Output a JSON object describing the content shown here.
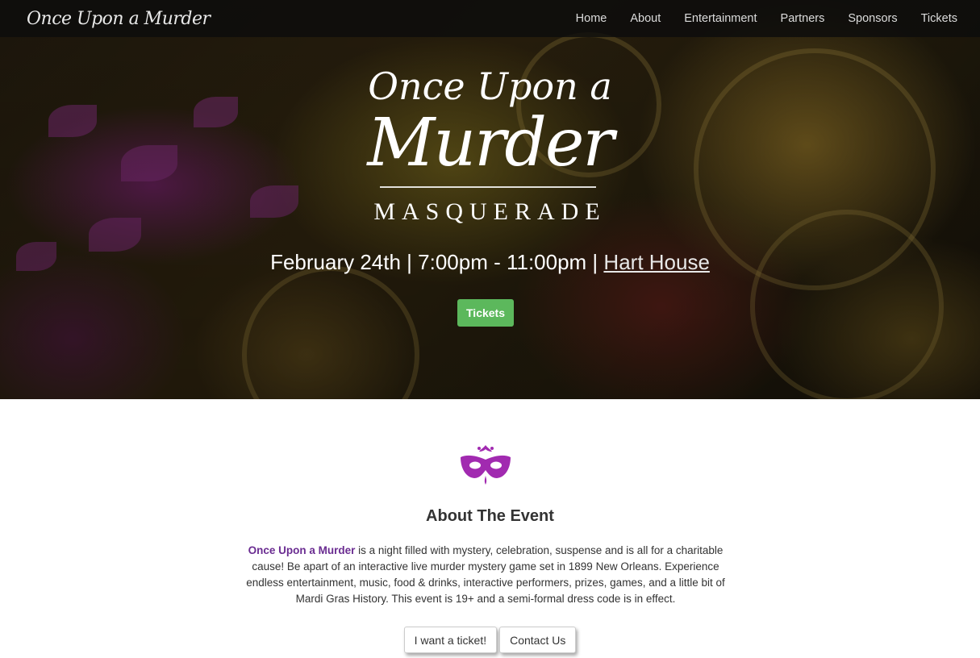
{
  "nav": {
    "brand": "Once Upon a Murder",
    "links": [
      "Home",
      "About",
      "Entertainment",
      "Partners",
      "Sponsors",
      "Tickets"
    ]
  },
  "hero": {
    "title_top": "Once Upon a",
    "title_main": "Murder",
    "title_sub": "MASQUERADE",
    "date_time": "February 24th | 7:00pm - 11:00pm | ",
    "venue": "Hart House",
    "button": "Tickets"
  },
  "about": {
    "icon": "masquerade-mask-icon",
    "heading": "About The Event",
    "highlight": "Once Upon a Murder",
    "text": " is a night filled with mystery, celebration, suspense and is all for a charitable cause! Be apart of an interactive live murder mystery game set in 1899 New Orleans. Experience endless entertainment, music, food & drinks, interactive performers, prizes, games, and a little bit of Mardi Gras History. This event is 19+ and a semi-formal dress code is in effect.",
    "buttons": [
      "I want a ticket!",
      "Contact Us"
    ]
  },
  "colors": {
    "accent_purple": "#6a2c91",
    "mask_purple": "#a12ab0",
    "ticket_green": "#5cb85c"
  }
}
